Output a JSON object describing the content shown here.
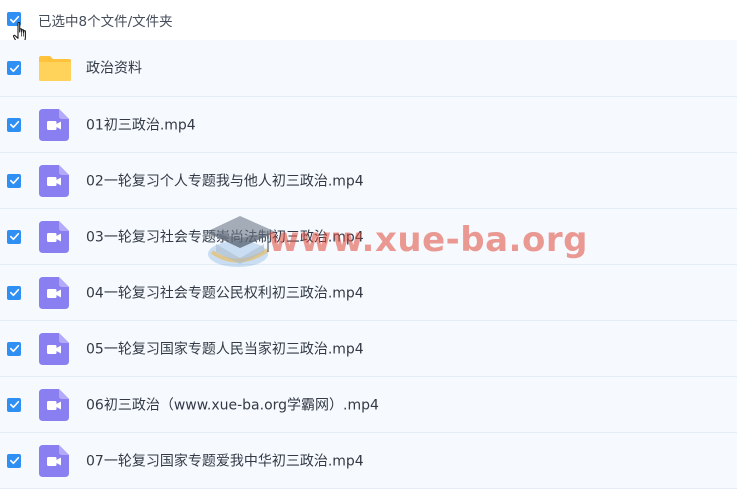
{
  "header": {
    "selection_text": "已选中8个文件/文件夹"
  },
  "files": [
    {
      "type": "folder",
      "name": "政治资料"
    },
    {
      "type": "video",
      "name": "01初三政治.mp4"
    },
    {
      "type": "video",
      "name": "02一轮复习个人专题我与他人初三政治.mp4"
    },
    {
      "type": "video",
      "name": "03一轮复习社会专题崇尚法制初三政治.mp4"
    },
    {
      "type": "video",
      "name": "04一轮复习社会专题公民权利初三政治.mp4"
    },
    {
      "type": "video",
      "name": "05一轮复习国家专题人民当家初三政治.mp4"
    },
    {
      "type": "video",
      "name": "06初三政治（www.xue-ba.org学霸网）.mp4"
    },
    {
      "type": "video",
      "name": "07一轮复习国家专题爱我中华初三政治.mp4"
    }
  ],
  "watermark": {
    "text": "www.xue-ba.org"
  },
  "colors": {
    "checkbox": "#2f8ff2",
    "video_icon": "#8a7ff0",
    "folder_icon": "#ffc83d",
    "row_background": "#f6faff"
  },
  "icons": {
    "video": "video-file-icon",
    "folder": "folder-icon",
    "checkbox": "checkmark-icon",
    "cursor": "hand-pointer-icon"
  }
}
